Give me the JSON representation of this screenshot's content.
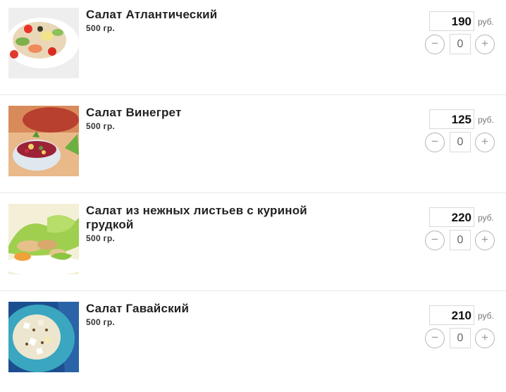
{
  "items": [
    {
      "name": "Салат Атлантический",
      "weight": "500 гр.",
      "price": "190",
      "currency": "руб.",
      "quantity": "0",
      "minus": "−",
      "plus": "+"
    },
    {
      "name": "Салат Винегрет",
      "weight": "500 гр.",
      "price": "125",
      "currency": "руб.",
      "quantity": "0",
      "minus": "−",
      "plus": "+"
    },
    {
      "name": "Салат из нежных листьев с куриной грудкой",
      "weight": "500 гр.",
      "price": "220",
      "currency": "руб.",
      "quantity": "0",
      "minus": "−",
      "plus": "+"
    },
    {
      "name": "Салат Гавайский",
      "weight": "500 гр.",
      "price": "210",
      "currency": "руб.",
      "quantity": "0",
      "minus": "−",
      "plus": "+"
    }
  ]
}
